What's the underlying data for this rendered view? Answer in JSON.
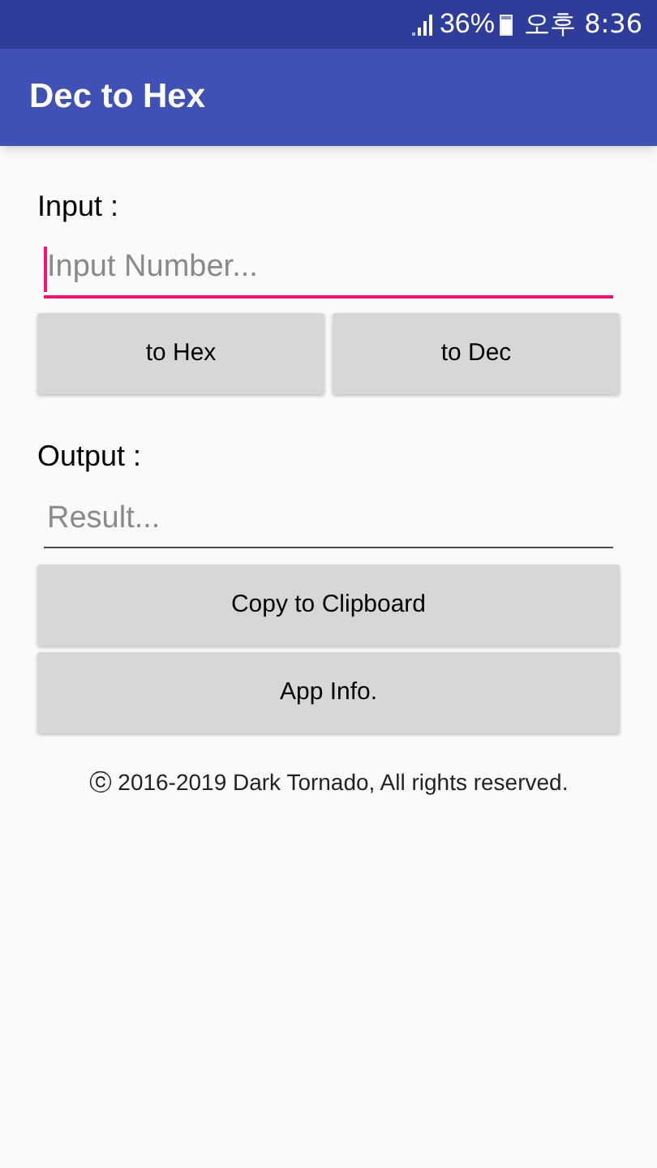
{
  "status_bar": {
    "battery": "36%",
    "time": "오후 8:36"
  },
  "app_bar": {
    "title": "Dec to Hex"
  },
  "input": {
    "label": "Input :",
    "placeholder": "Input Number...",
    "focused": true
  },
  "convert_buttons": [
    "to Hex",
    "to Dec"
  ],
  "output": {
    "label": "Output :",
    "placeholder": "Result...",
    "focused": false
  },
  "action_buttons": [
    "Copy to Clipboard",
    "App Info."
  ],
  "footer": "ⓒ 2016-2019 Dark Tornado, All rights reserved."
}
